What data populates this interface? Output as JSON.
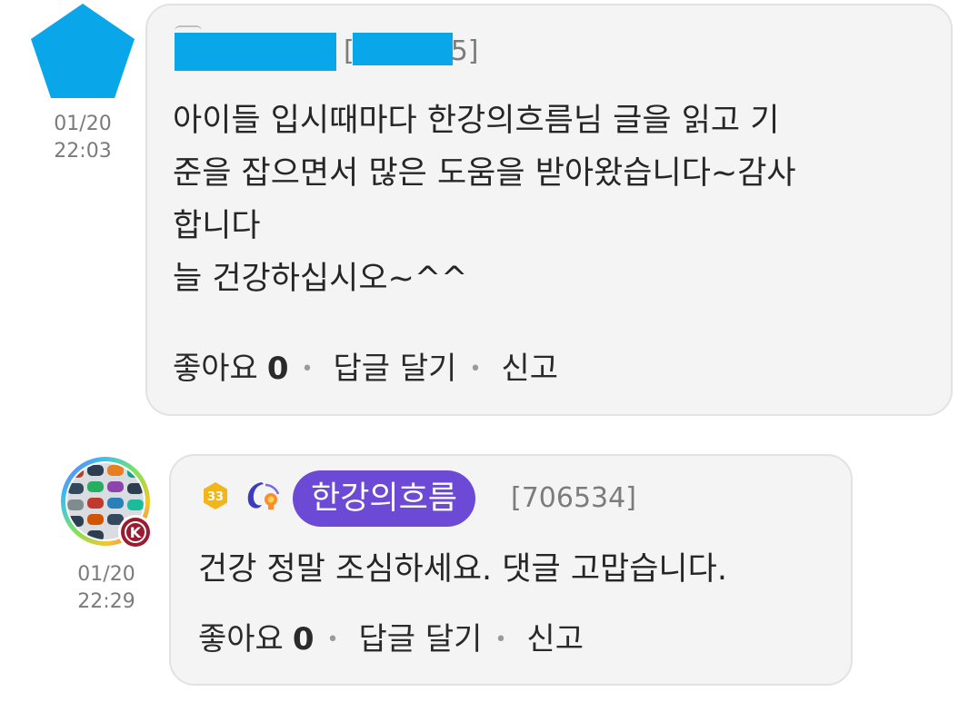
{
  "comments": [
    {
      "member_id_prefix": "[",
      "member_id_suffix": "5]",
      "time": {
        "date": "01/20",
        "clock": "22:03"
      },
      "body": "아이들 입시때마다 한강의흐름님 글을 읽고 기\n준을 잡으면서 많은 도움을 받아왔습니다~감사\n합니다\n늘 건강하십시오~^^",
      "actions": {
        "like_label": "좋아요",
        "like_count": "0",
        "reply_label": "답글 달기",
        "report_label": "신고"
      }
    },
    {
      "level": "33",
      "author": "한강의흐름",
      "member_id": "[706534]",
      "avatar_badge": "K",
      "time": {
        "date": "01/20",
        "clock": "22:29"
      },
      "body": "건강 정말 조심하세요. 댓글 고맙습니다.",
      "actions": {
        "like_label": "좋아요",
        "like_count": "0",
        "reply_label": "답글 달기",
        "report_label": "신고"
      }
    }
  ],
  "colors": {
    "pentagon_avatar": "#0aa6ea",
    "privacy_mask": "#0aa6ea",
    "author_pill": "#6c4ad6",
    "level_badge": "#f2b51b",
    "bubble_bg": "#f4f4f4"
  },
  "icons": {
    "level_badge": "hexagon-level-badge-icon",
    "award": "crescent-award-icon",
    "avatar_badge": "k-circle-badge-icon"
  }
}
